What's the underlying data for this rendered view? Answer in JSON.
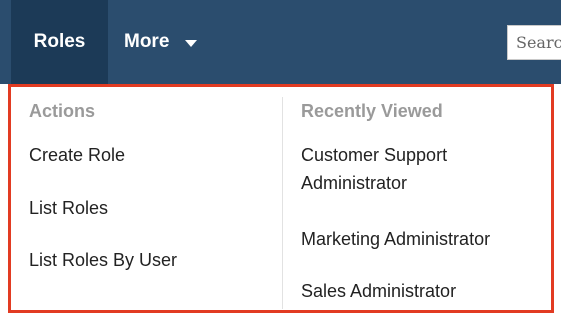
{
  "navbar": {
    "tabs": [
      {
        "label": "Roles"
      },
      {
        "label": "More"
      }
    ],
    "search": {
      "placeholder": "Search"
    }
  },
  "dropdown": {
    "actions": {
      "header": "Actions",
      "items": [
        "Create Role",
        "List Roles",
        "List Roles By User"
      ]
    },
    "recently_viewed": {
      "header": "Recently Viewed",
      "items": [
        "Customer Support Administrator",
        "Marketing Administrator",
        "Sales Administrator"
      ]
    }
  },
  "colors": {
    "navbar_bg": "#2b4d6e",
    "active_tab_bg": "#1c3a57",
    "highlight_border": "#e23b22",
    "header_text": "#9a9a9a"
  }
}
